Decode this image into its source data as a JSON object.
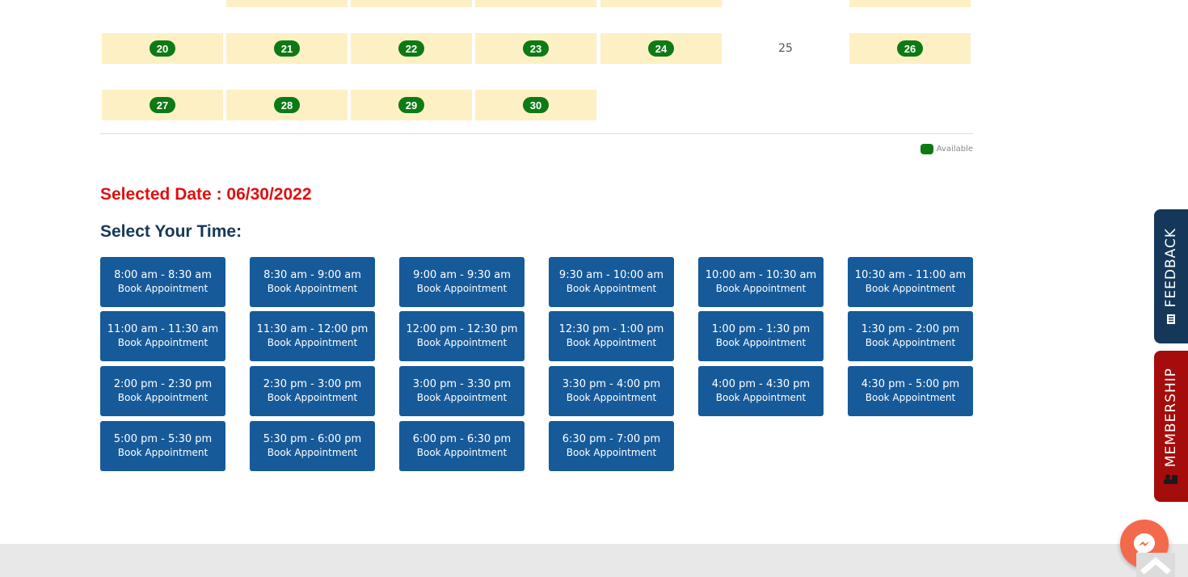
{
  "calendar": {
    "row0": [
      "",
      "",
      "",
      "",
      "",
      "",
      ""
    ],
    "row0_avail": [
      false,
      true,
      true,
      true,
      true,
      false,
      true
    ],
    "row1": [
      "20",
      "21",
      "22",
      "23",
      "24",
      "25",
      "26"
    ],
    "row1_avail": [
      true,
      true,
      true,
      true,
      true,
      false,
      true
    ],
    "row2": [
      "27",
      "28",
      "29",
      "30"
    ],
    "row2_avail": [
      true,
      true,
      true,
      true
    ],
    "legend_label": "Available",
    "available_color": "#0d7a14",
    "available_bg": "#fdf0c4"
  },
  "selected_date": "Selected Date : 06/30/2022",
  "select_time_heading": "Select Your Time:",
  "slot_action_label": "Book Appointment",
  "slots": [
    [
      "8:00 am - 8:30 am",
      "8:30 am - 9:00 am",
      "9:00 am - 9:30 am",
      "9:30 am - 10:00 am",
      "10:00 am - 10:30 am",
      "10:30 am - 11:00 am"
    ],
    [
      "11:00 am - 11:30 am",
      "11:30 am - 12:00 pm",
      "12:00 pm - 12:30 pm",
      "12:30 pm - 1:00 pm",
      "1:00 pm - 1:30 pm",
      "1:30 pm - 2:00 pm"
    ],
    [
      "2:00 pm - 2:30 pm",
      "2:30 pm - 3:00 pm",
      "3:00 pm - 3:30 pm",
      "3:30 pm - 4:00 pm",
      "4:00 pm - 4:30 pm",
      "4:30 pm - 5:00 pm"
    ],
    [
      "5:00 pm - 5:30 pm",
      "5:30 pm - 6:00 pm",
      "6:00 pm - 6:30 pm",
      "6:30 pm - 7:00 pm"
    ]
  ],
  "side_tabs": {
    "feedback": "FEEDBACK",
    "membership": "MEMBERSHIP"
  },
  "colors": {
    "slot_bg": "#165a9a",
    "selected_date": "#e01010",
    "heading": "#17385a",
    "feedback_tab": "#15385a",
    "membership_tab": "#a50c0c",
    "messenger": "#f26a4b"
  },
  "icons": {
    "messenger": "messenger-icon",
    "scroll_top": "chevron-up-icon",
    "feedback": "feedback-icon",
    "membership": "membership-icon"
  }
}
